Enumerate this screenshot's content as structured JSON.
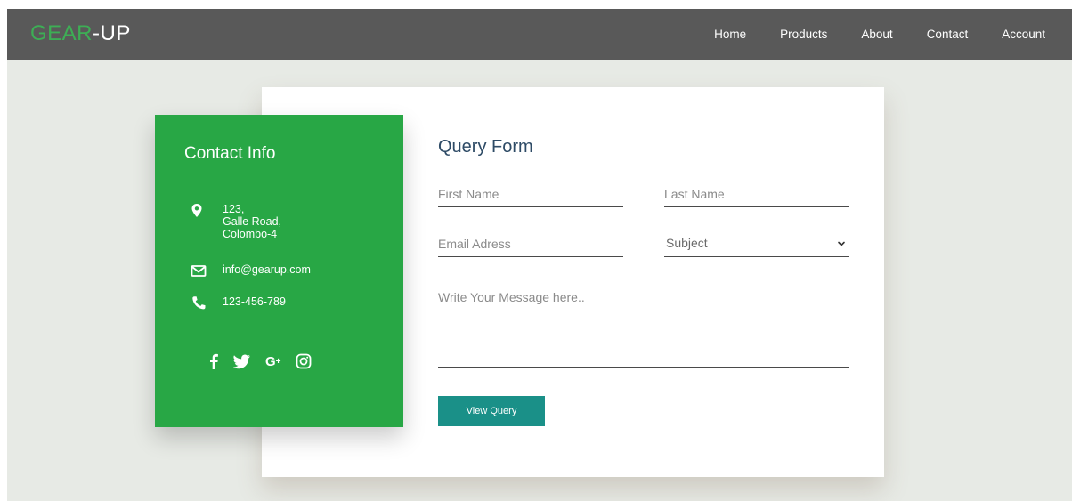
{
  "navbar": {
    "logo_accent": "GEAR",
    "logo_rest": "-UP",
    "links": [
      "Home",
      "Products",
      "About",
      "Contact",
      "Account"
    ]
  },
  "contact_info": {
    "title": "Contact Info",
    "address_lines": [
      "123,",
      "Galle Road,",
      "Colombo-4"
    ],
    "email": "info@gearup.com",
    "phone": "123-456-789",
    "social_icons": [
      "facebook-icon",
      "twitter-icon",
      "google-plus-icon",
      "instagram-icon"
    ]
  },
  "query_form": {
    "title": "Query Form",
    "first_name_placeholder": "First Name",
    "last_name_placeholder": "Last Name",
    "email_placeholder": "Email Adress",
    "subject_selected": "Subject",
    "message_placeholder": "Write Your Message here..",
    "button_label": "View Query"
  },
  "colors": {
    "navbar_bg": "#595959",
    "logo_accent": "#3dae55",
    "page_bg": "#e7eae5",
    "contact_card_bg": "#28a745",
    "button_bg": "#1a9088",
    "form_title": "#2e4b66"
  }
}
